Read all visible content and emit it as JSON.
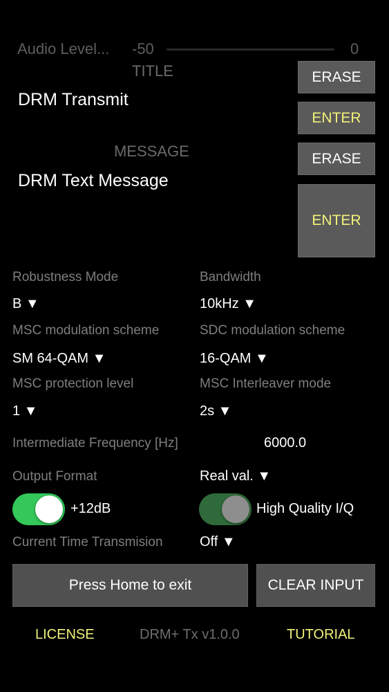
{
  "audio": {
    "label": "Audio Level...",
    "min": "-50",
    "max": "0"
  },
  "title_section": {
    "heading": "TITLE",
    "value": "DRM Transmit",
    "erase": "ERASE",
    "enter": "ENTER"
  },
  "message_section": {
    "heading": "MESSAGE",
    "value": "DRM Text Message",
    "erase": "ERASE",
    "enter": "ENTER"
  },
  "settings": {
    "robustness": {
      "label": "Robustness Mode",
      "value": "B ▼"
    },
    "bandwidth": {
      "label": "Bandwidth",
      "value": "10kHz ▼"
    },
    "msc_mod": {
      "label": "MSC modulation scheme",
      "value": "SM 64-QAM ▼"
    },
    "sdc_mod": {
      "label": "SDC modulation scheme",
      "value": "16-QAM ▼"
    },
    "msc_prot": {
      "label": "MSC protection level",
      "value": "1 ▼"
    },
    "msc_interleaver": {
      "label": "MSC Interleaver mode",
      "value": "2s ▼"
    },
    "if_freq": {
      "label": "Intermediate Frequency [Hz]",
      "value": "6000.0"
    },
    "output_format": {
      "label": "Output Format",
      "value": "Real val. ▼"
    },
    "gain_toggle": {
      "label": "+12dB",
      "on": true
    },
    "hq_toggle": {
      "label": "High Quality I/Q",
      "on": true
    },
    "time_tx": {
      "label": "Current Time Transmision",
      "value": "Off ▼"
    }
  },
  "actions": {
    "home": "Press Home to exit",
    "clear": "CLEAR INPUT"
  },
  "footer": {
    "license": "LICENSE",
    "version": "DRM+ Tx v1.0.0",
    "tutorial": "TUTORIAL"
  },
  "colors": {
    "toggle_on": "#34c759",
    "toggle_on_dim": "#2f6b3a",
    "accent_yellow": "#f2f27a"
  }
}
